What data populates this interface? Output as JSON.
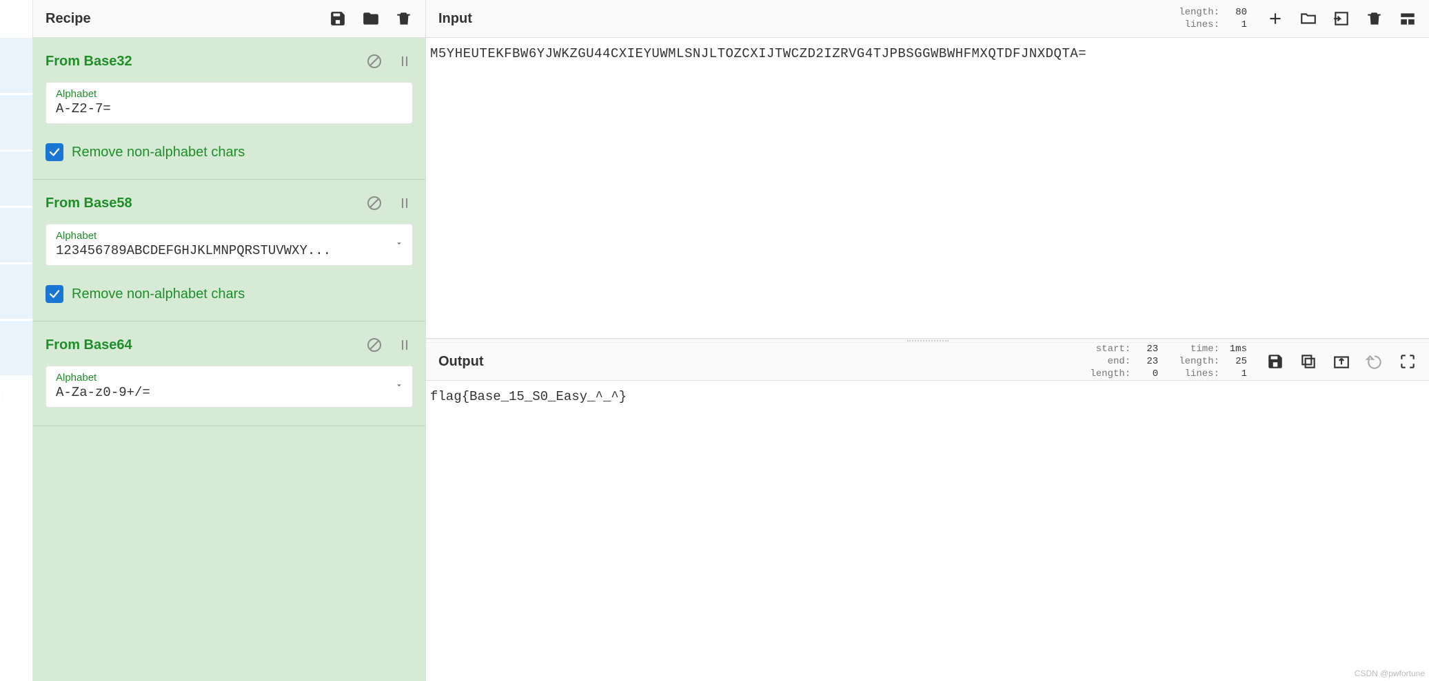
{
  "recipe": {
    "title": "Recipe",
    "operations": [
      {
        "name": "From Base32",
        "field_label": "Alphabet",
        "field_value": "A-Z2-7=",
        "has_dropdown": false,
        "checkbox_label": "Remove non-alphabet chars",
        "checkbox_checked": true
      },
      {
        "name": "From Base58",
        "field_label": "Alphabet",
        "field_value": "123456789ABCDEFGHJKLMNPQRSTUVWXY...",
        "has_dropdown": true,
        "checkbox_label": "Remove non-alphabet chars",
        "checkbox_checked": true
      },
      {
        "name": "From Base64",
        "field_label": "Alphabet",
        "field_value": "A-Za-z0-9+/=",
        "has_dropdown": true,
        "checkbox_label": "",
        "checkbox_checked": false
      }
    ]
  },
  "input": {
    "title": "Input",
    "stats": {
      "length_label": "length:",
      "length_val": "80",
      "lines_label": "lines:",
      "lines_val": "1"
    },
    "text": "M5YHEUTEKFBW6YJWKZGU44CXIEYUWMLSNJLTOZCXIJTWCZD2IZRVG4TJPBSGGWBWHFMXQTDFJNXDQTA="
  },
  "output": {
    "title": "Output",
    "stats": {
      "start_label": "start:",
      "start_val": "23",
      "end_label": "end:",
      "end_val": "23",
      "length_label": "length:",
      "length_val": "0",
      "time_label": "time:",
      "time_val": "1ms",
      "olength_label": "length:",
      "olength_val": "25",
      "lines_label": "lines:",
      "lines_val": "1"
    },
    "text": "flag{Base_15_S0_Easy_^_^}"
  },
  "watermark": "CSDN @pwfortune"
}
